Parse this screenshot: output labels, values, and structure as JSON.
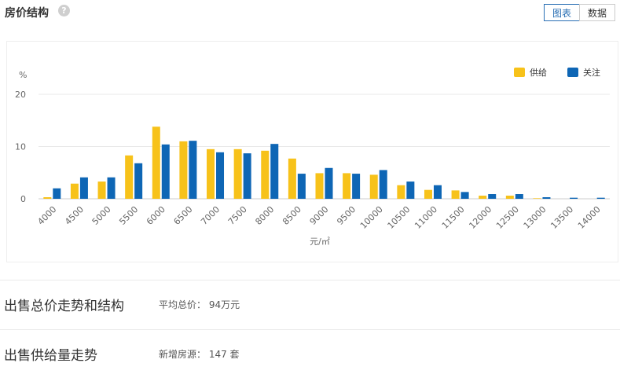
{
  "header": {
    "title": "房价结构",
    "help_icon": "question-circle-icon"
  },
  "view_toggle": {
    "chart_label": "图表",
    "data_label": "数据",
    "active": "chart"
  },
  "colors": {
    "supply": "#f7c21a",
    "attention": "#0e66b5",
    "active": "#2a6fb4"
  },
  "chart_data": {
    "type": "bar",
    "categories": [
      "4000",
      "4500",
      "5000",
      "5500",
      "6000",
      "6500",
      "7000",
      "7500",
      "8000",
      "8500",
      "9000",
      "9500",
      "10000",
      "10500",
      "11000",
      "11500",
      "12000",
      "12500",
      "13000",
      "13500",
      "14000"
    ],
    "series": [
      {
        "name": "供给",
        "values": [
          0.3,
          2.9,
          3.3,
          8.3,
          13.8,
          11.0,
          9.5,
          9.5,
          9.2,
          7.7,
          4.9,
          4.9,
          4.6,
          2.6,
          1.7,
          1.6,
          0.6,
          0.6,
          0.1,
          0.0,
          0.0
        ]
      },
      {
        "name": "关注",
        "values": [
          2.0,
          4.1,
          4.1,
          6.8,
          10.4,
          11.1,
          8.9,
          8.7,
          10.5,
          4.8,
          5.9,
          4.8,
          5.5,
          3.3,
          2.6,
          1.3,
          0.9,
          0.9,
          0.3,
          0.2,
          0.2
        ]
      }
    ],
    "xlabel": "元/㎡",
    "ylabel": "%",
    "yticks": [
      "0",
      "10",
      "20"
    ],
    "ylim": [
      0,
      20
    ],
    "grid": true,
    "legend_position": "top-right"
  },
  "sections": [
    {
      "title": "出售总价走势和结构",
      "stat": "平均总价：  94万元"
    },
    {
      "title": "出售供给量走势",
      "stat": "新增房源：  147 套"
    }
  ]
}
